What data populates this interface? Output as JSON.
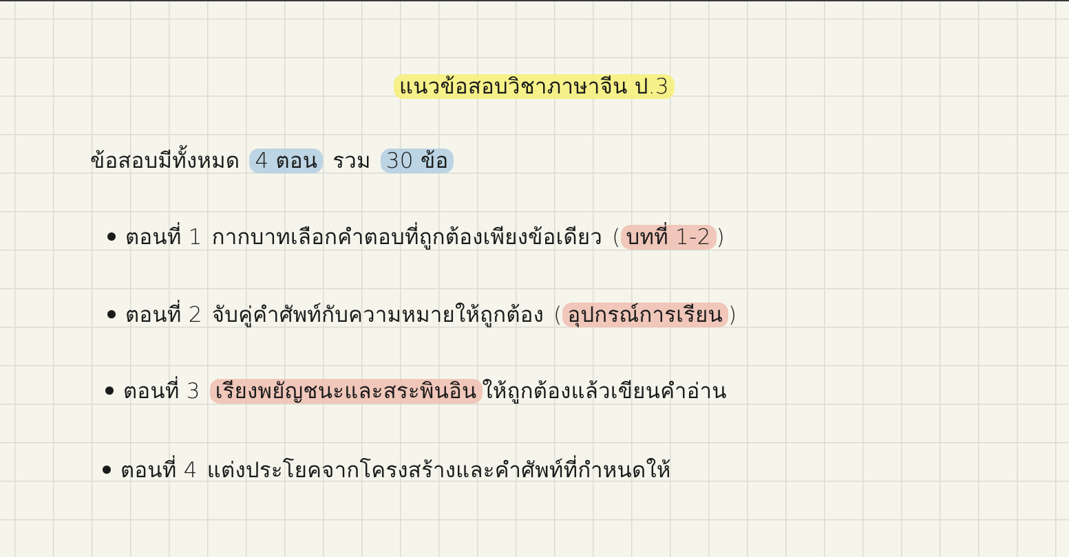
{
  "title": "แนวข้อสอบวิชาภาษาจีน ป.3",
  "summary": {
    "prefix": "ข้อสอบมีทั้งหมด",
    "sections_hl": "4 ตอน",
    "middle": "รวม",
    "questions_hl": "30 ข้อ"
  },
  "parts": [
    {
      "label": "ตอนที่ 1",
      "desc": "กากบาทเลือกคำตอบที่ถูกต้องเพียงข้อเดียว",
      "open": "(",
      "note_hl": "บทที่ 1-2",
      "close": ")"
    },
    {
      "label": "ตอนที่ 2",
      "desc": "จับคู่คำศัพท์กับความหมายให้ถูกต้อง",
      "open": "(",
      "note_hl": "อุปกรณ์การเรียน",
      "close": ")"
    },
    {
      "label": "ตอนที่ 3",
      "hl": "เรียงพยัญชนะและสระพินอิน",
      "rest": "ให้ถูกต้องแล้วเขียนคำอ่าน"
    },
    {
      "label": "ตอนที่ 4",
      "desc": "แต่งประโยคจากโครงสร้างและคำศัพท์ที่กำหนดให้"
    }
  ],
  "colors": {
    "background": "#f6f5ec",
    "grid": "#dcdcd2",
    "highlight_yellow": "#f6f078",
    "highlight_blue": "#b2cee2",
    "highlight_red": "#eebeb2"
  }
}
